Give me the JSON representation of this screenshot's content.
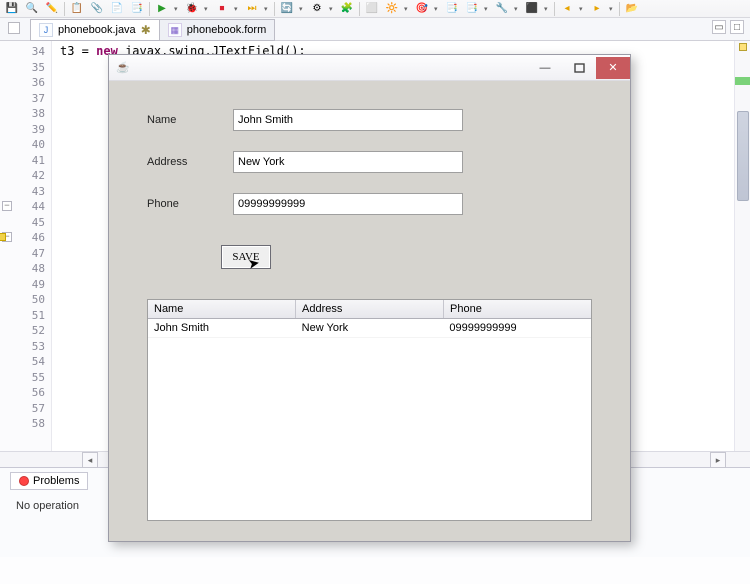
{
  "toolbar": {
    "icons": [
      "💾",
      "🔍",
      "✏️",
      "📋",
      "📎",
      "📄",
      "📑",
      "▶",
      "🐞",
      "⏹",
      "⏭",
      "🔄",
      "⚙",
      "🧩",
      "⬜",
      "🔆",
      "🎯",
      "📑",
      "📑",
      "🔧",
      "⬛",
      "▸",
      "▾",
      "↺"
    ]
  },
  "tabs": {
    "active": {
      "label": "phonebook.java",
      "dirty": "✱"
    },
    "inactive": {
      "label": "phonebook.form"
    }
  },
  "gutter": {
    "start": 34,
    "end": 58
  },
  "code": {
    "line34_a": "t3 = ",
    "line34_kw": "new",
    "line34_b": " javax.swing.JTextField();"
  },
  "dialog": {
    "fields": {
      "name_label": "Name",
      "name_value": "John Smith",
      "address_label": "Address",
      "address_value": "New York",
      "phone_label": "Phone",
      "phone_value": "09999999999"
    },
    "save_label": "SAVE",
    "table": {
      "headers": [
        "Name",
        "Address",
        "Phone"
      ],
      "rows": [
        {
          "name": "John Smith",
          "address": "New York",
          "phone": "09999999999"
        }
      ]
    },
    "win_min": "—",
    "java_cup": "☕"
  },
  "problems": {
    "tab_label": "Problems",
    "message": "No operation"
  }
}
